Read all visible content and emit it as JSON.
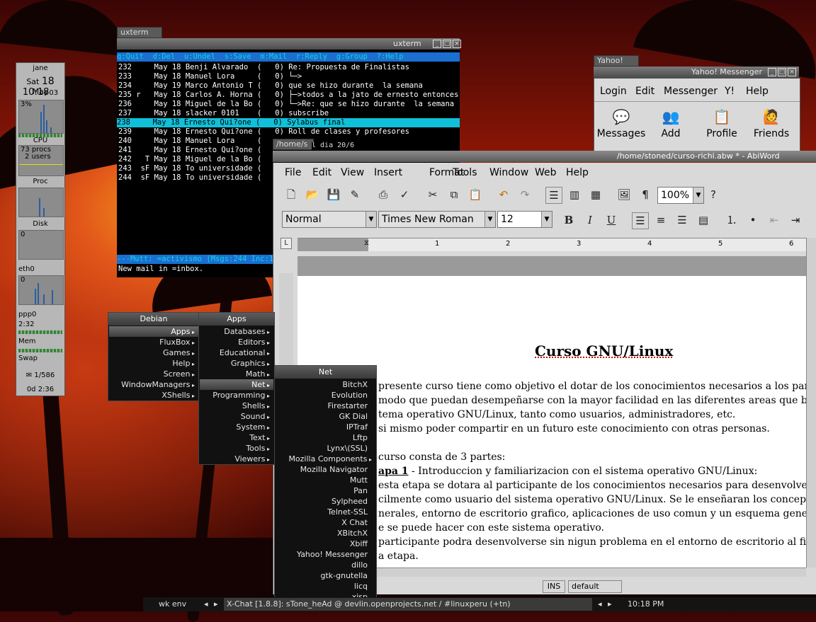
{
  "gkrellm": {
    "user": "jane",
    "date_day": "Sat",
    "date_num": "18",
    "date_month": "May",
    "time": "10:18",
    "time_sec": "03",
    "cpu_pct": "3%",
    "cpu_label": "CPU",
    "procs": "73 procs",
    "users": "2 users",
    "proc_label": "Proc",
    "disk_label": "Disk",
    "disk_val": "0",
    "eth_label": "eth0",
    "eth_val": "0",
    "ppp_label": "ppp0",
    "ppp_time": "2:32",
    "mem_label": "Mem",
    "swap_label": "Swap",
    "mail_count": "1/586",
    "uptime": "0d  2:36"
  },
  "xterm": {
    "tab": "uxterm",
    "title": "uxterm",
    "header": "q:Quit  d:Del  u:Undel  s:Save  m:Mail  r:Reply  g:Group  ?:Help",
    "rows": [
      "232     May 18 Benji Alvarado  (   0) Re: Propuesta de Finalistas",
      "233     May 18 Manuel Lora     (   0) └─>",
      "234     May 19 Marco Antonio T (   0) que se hizo durante  la semana",
      "235 r   May 18 Carlos A. Horna (   0) ├─>todos a la jato de ernesto entonces",
      "236     May 18 Miguel de la Bo (   0) └─>Re: que se hizo durante  la semana",
      "237     May 18 slacker 0101    (   0) subscribe",
      "238     May 18 Ernesto Qui?one (   0) Sylabus final",
      "239     May 18 Ernesto Qui?one (   0) Roll de clases y profesores",
      "240     May 18 Manuel Lora     (",
      "241     May 18 Ernesto Qui?one (",
      "242   T May 18 Miguel de la Bo (",
      "243  sF May 18 To universidade (",
      "244  sF May 18 To universidade ("
    ],
    "status": "---Mutt: =activismo [Msgs:244 Inc:1",
    "newmail": "New mail in =inbox.",
    "home_tab": "/home/s",
    "peek_text": "l dia 20/6"
  },
  "yahoo": {
    "tab": "Yahoo!",
    "title": "Yahoo! Messenger",
    "menu": [
      "Login",
      "Edit",
      "Messenger",
      "Y!",
      "Help"
    ],
    "buttons": [
      "Messages",
      "Add",
      "Profile",
      "Friends"
    ]
  },
  "abiword": {
    "title": "/home/stoned/curso-richi.abw * - AbiWord",
    "menu": [
      "File",
      "Edit",
      "View",
      "Insert",
      "Format",
      "Tools",
      "Window",
      "Web",
      "Help"
    ],
    "zoom": "100%",
    "style": "Normal",
    "font": "Times New Roman",
    "size": "12",
    "ruler_numbers": [
      "1",
      "2",
      "3",
      "4",
      "5",
      "6"
    ],
    "doc": {
      "heading": "Curso GNU/Linux",
      "lines": [
        "presente curso tiene como objetivo el dotar de los conocimientos necesarios a los participantes",
        "modo que puedan desempeñarse con la mayor facilidad en las diferentes areas que brinda el",
        "tema operativo GNU/Linux, tanto como usuarios, administradores, etc.",
        "si mismo poder compartir en un futuro este conocimiento con otras personas.",
        "curso consta de 3 partes:",
        "apa 1",
        " - Introduccion y familiarizacion con el sistema operativo GNU/Linux:",
        "esta etapa se dotara al participante de los conocimientos necesarios para desenvolverse",
        "cilmente como usuario del sistema operativo GNU/Linux. Se le enseñaran los conceptos",
        "nerales, entorno de escritorio grafico, aplicaciones de uso comun y un esquema general de lo",
        "e se puede hacer con este sistema operativo.",
        "participante podra desenvolverse sin nigun problema en el entorno de escritorio al finalizar",
        "a etapa."
      ]
    },
    "status_ins": "INS",
    "status_lang": "default"
  },
  "menus": {
    "debian": {
      "title": "Debian",
      "items": [
        "Apps",
        "FluxBox",
        "Games",
        "Help",
        "Screen",
        "WindowManagers",
        "XShells"
      ]
    },
    "apps": {
      "title": "Apps",
      "items": [
        "Databases",
        "Editors",
        "Educational",
        "Graphics",
        "Math",
        "Net",
        "Programming",
        "Shells",
        "Sound",
        "System",
        "Text",
        "Tools",
        "Viewers"
      ]
    },
    "net": {
      "title": "Net",
      "items": [
        "BitchX",
        "Evolution",
        "Firestarter",
        "GK Dial",
        "IPTraf",
        "Lftp",
        "Lynx\\(SSL)",
        "Mozilla Components",
        "Mozilla Navigator",
        "Mutt",
        "Pan",
        "Sylpheed",
        "Telnet-SSL",
        "X Chat",
        "XBitchX",
        "Xbiff",
        "Yahoo! Messenger",
        "dillo",
        "gtk-gnutella",
        "licq",
        "xisp"
      ]
    }
  },
  "taskbar": {
    "workspace": "wk env",
    "window": "X-Chat [1.8.8]: sTone_heAd @ devlin.openprojects.net / #linuxperu (+tn)",
    "clock": "10:18 PM"
  }
}
